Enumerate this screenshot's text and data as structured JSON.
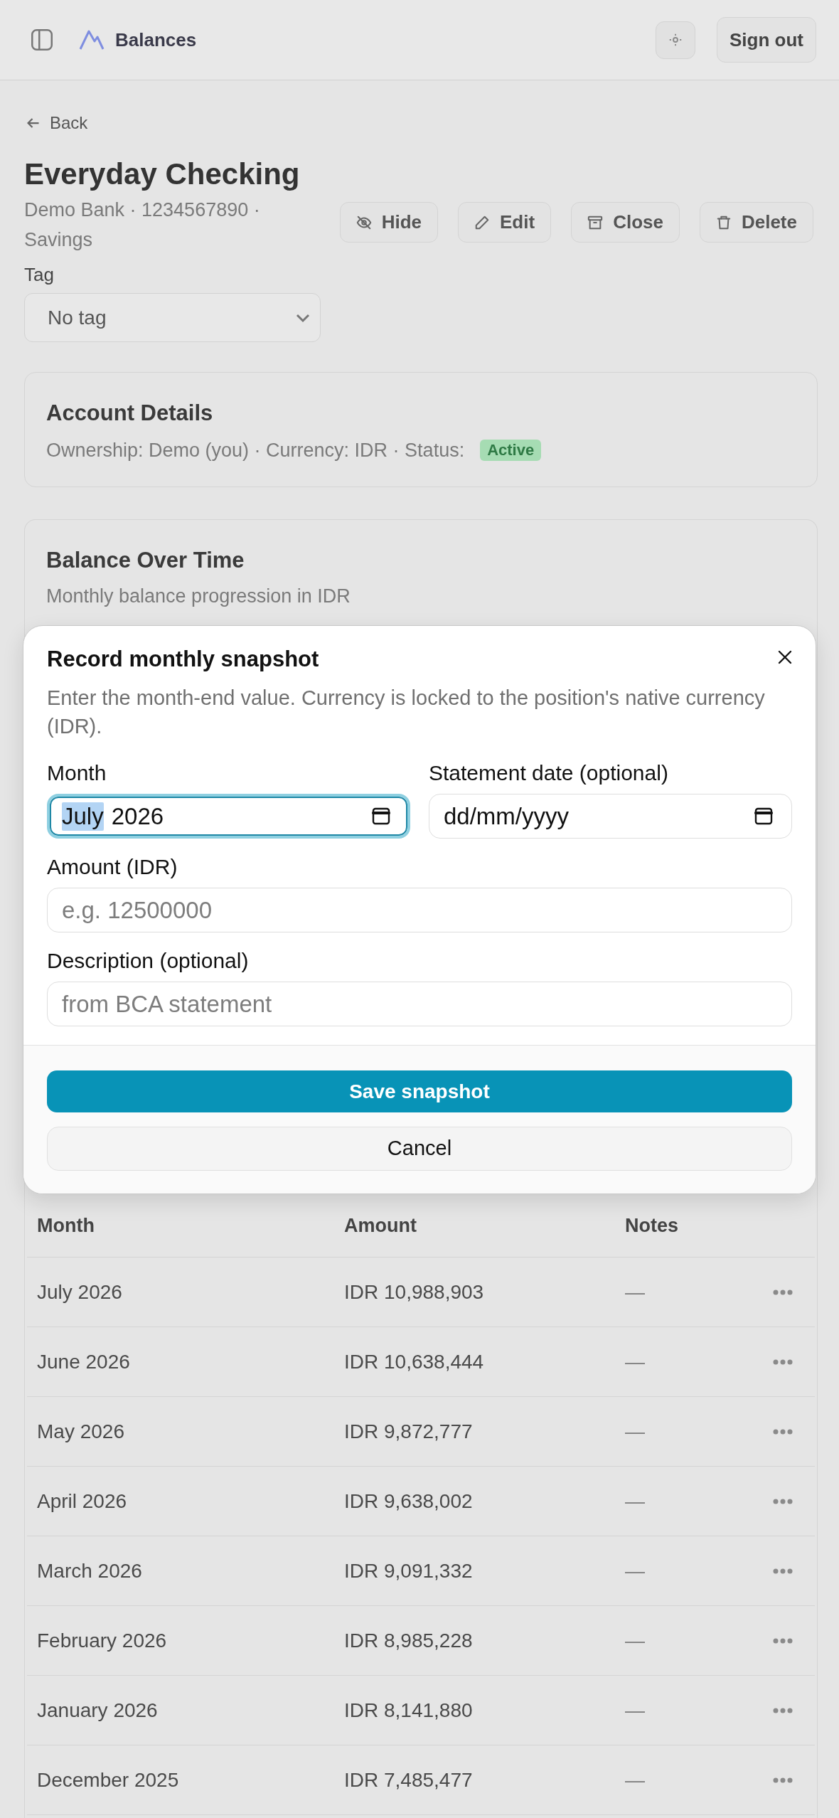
{
  "top_bar": {
    "brand": "Balances",
    "sign_out": "Sign out"
  },
  "back_link": {
    "label": "Back"
  },
  "account": {
    "title": "Everyday Checking",
    "subtitle": "Demo Bank · 1234567890 · Savings",
    "actions": [
      "Hide",
      "Edit",
      "Close",
      "Delete"
    ],
    "tag": {
      "label": "Tag",
      "value": "No tag"
    }
  },
  "account_details": {
    "title": "Account Details",
    "text": "Ownership: Demo (you) · Currency: IDR · Status:",
    "status": "Active"
  },
  "balance_over_time": {
    "title": "Balance Over Time",
    "subtitle": "Monthly balance progression in IDR"
  },
  "snapshots_table": {
    "columns": [
      "Month",
      "Amount",
      "Notes"
    ],
    "rows": [
      {
        "month": "July 2026",
        "amount": "IDR 10,988,903",
        "notes": "—"
      },
      {
        "month": "June 2026",
        "amount": "IDR 10,638,444",
        "notes": "—"
      },
      {
        "month": "May 2026",
        "amount": "IDR 9,872,777",
        "notes": "—"
      },
      {
        "month": "April 2026",
        "amount": "IDR 9,638,002",
        "notes": "—"
      },
      {
        "month": "March 2026",
        "amount": "IDR 9,091,332",
        "notes": "—"
      },
      {
        "month": "February 2026",
        "amount": "IDR 8,985,228",
        "notes": "—"
      },
      {
        "month": "January 2026",
        "amount": "IDR 8,141,880",
        "notes": "—"
      },
      {
        "month": "December 2025",
        "amount": "IDR 7,485,477",
        "notes": "—"
      }
    ]
  },
  "dialog": {
    "title": "Record monthly snapshot",
    "description": "Enter the month-end value. Currency is locked to the position's native currency (IDR).",
    "rows": [
      {
        "fields": [
          {
            "kind": "month",
            "label": "Month",
            "focused": true,
            "segments": [
              {
                "text": "July",
                "selected": true
              },
              {
                "text": "2026",
                "selected": false
              }
            ]
          },
          {
            "kind": "date",
            "label": "Statement date (optional)",
            "focused": false,
            "placeholder": "dd/mm/yyyy"
          }
        ]
      },
      {
        "fields": [
          {
            "kind": "text",
            "label": "Amount (IDR)",
            "focused": false,
            "placeholder": "e.g. 12500000"
          }
        ]
      },
      {
        "fields": [
          {
            "kind": "text",
            "label": "Description (optional)",
            "focused": false,
            "placeholder": "from BCA statement"
          }
        ]
      }
    ],
    "primary_button": "Save snapshot",
    "secondary_button": "Cancel"
  }
}
